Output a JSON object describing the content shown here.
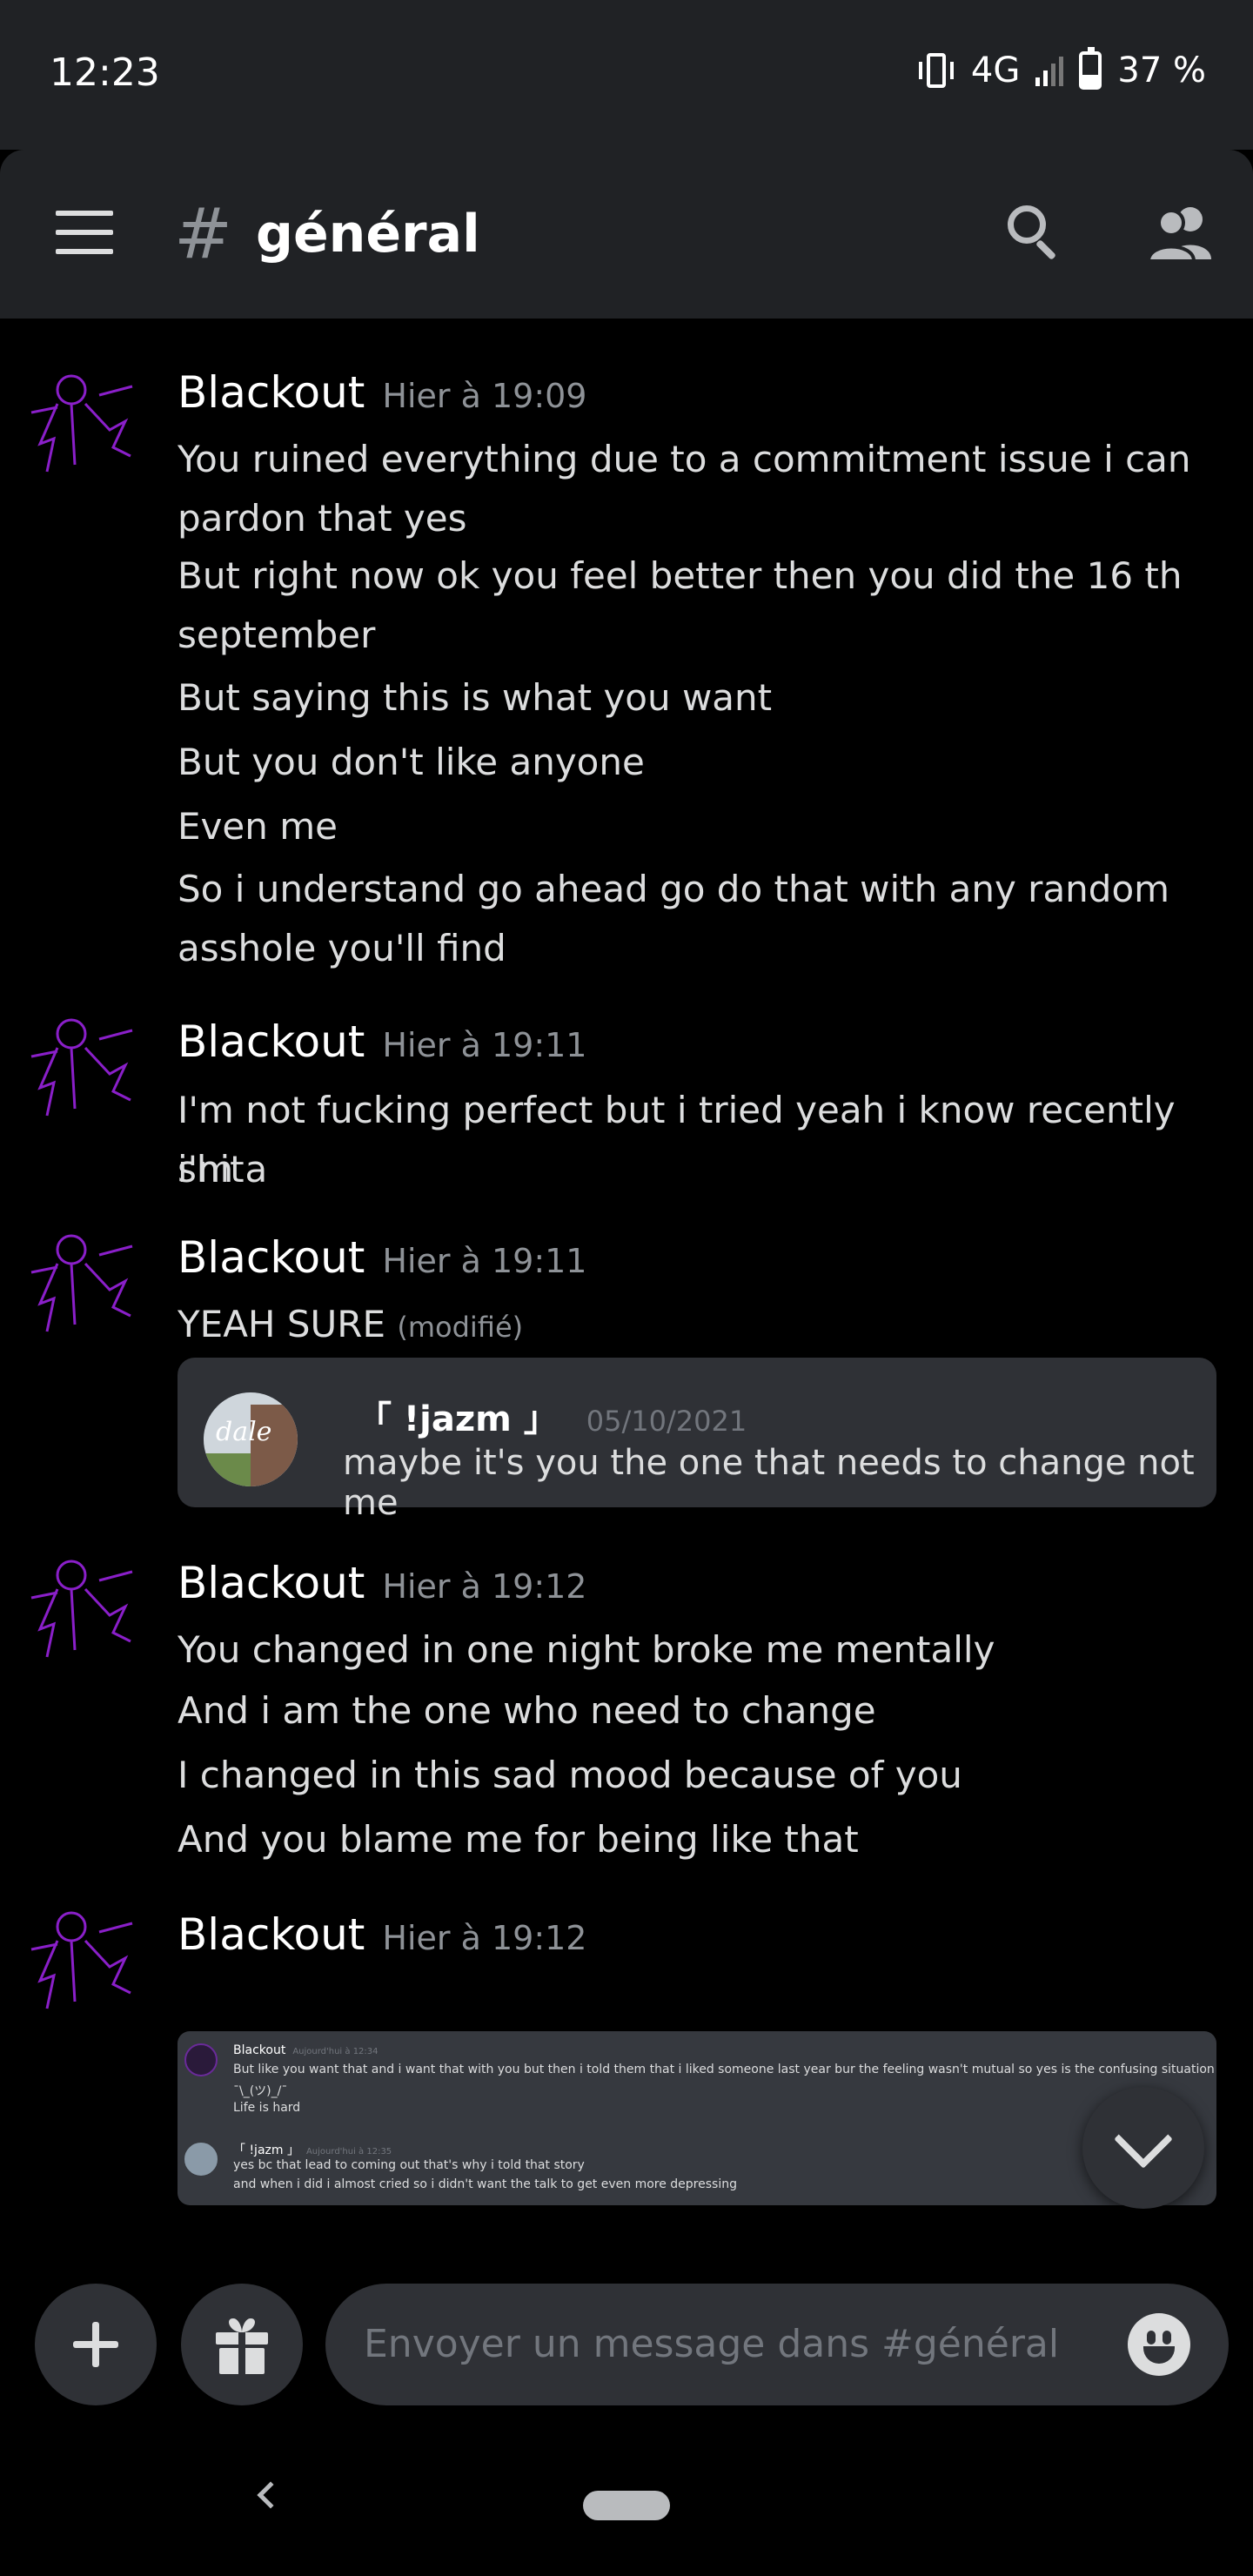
{
  "status_bar": {
    "time": "12:23",
    "network": "4G",
    "battery": "37 %",
    "battery_level": 0.37
  },
  "header": {
    "hash": "#",
    "channel": "général",
    "menu_icon": "hamburger-menu-icon",
    "search_icon": "search-icon",
    "members_icon": "members-icon"
  },
  "messages": [
    {
      "author": "Blackout",
      "time": "Hier à 19:09",
      "lines": [
        "You ruined everything due to a commitment issue i can",
        "pardon that yes",
        "But right now ok you feel better then you did the 16 th",
        "september",
        "But saying this is what you want",
        "But you don't like anyone",
        "Even me",
        "So i understand go ahead go do that with any random",
        "asshole you'll find"
      ]
    },
    {
      "author": "Blackout",
      "time": "Hier à 19:11",
      "lines": [
        "I'm not fucking perfect but i tried yeah i know recently i'm a",
        "shit"
      ]
    },
    {
      "author": "Blackout",
      "time": "Hier à 19:11",
      "text": "YEAH SURE",
      "edited": "(modifié)",
      "embed": {
        "author": "「 !jazm 」",
        "date": "05/10/2021",
        "text": "maybe it's you the one that needs to change not me",
        "avatar_text": "dale"
      }
    },
    {
      "author": "Blackout",
      "time": "Hier à 19:12",
      "lines": [
        "You changed in one night broke me mentally",
        "And i am the one who need to change",
        "I changed in this sad mood because of you",
        "And you blame me for being like that"
      ]
    },
    {
      "author": "Blackout",
      "time": "Hier à 19:12",
      "screenshot": {
        "msg1_author": "Blackout",
        "msg1_time": "Aujourd'hui à 12:34",
        "msg1_line1": "But like you want that and i want that with you but then i told them that i liked someone last year bur the feeling wasn't mutual so yes is the confusing situation",
        "msg1_line2": "¯\\_(ツ)_/¯",
        "msg1_line3": "Life is hard",
        "msg2_author": "「 !jazm 」",
        "msg2_time": "Aujourd'hui à 12:35",
        "msg2_line1": "yes bc that lead to coming out that's why i told that story",
        "msg2_line2": "and when i did i almost cried so i didn't want the talk to get even more depressing"
      }
    }
  ],
  "composer": {
    "placeholder": "Envoyer un message dans #général",
    "add_icon": "plus-icon",
    "gift_icon": "gift-icon",
    "emoji_icon": "emoji-icon"
  }
}
